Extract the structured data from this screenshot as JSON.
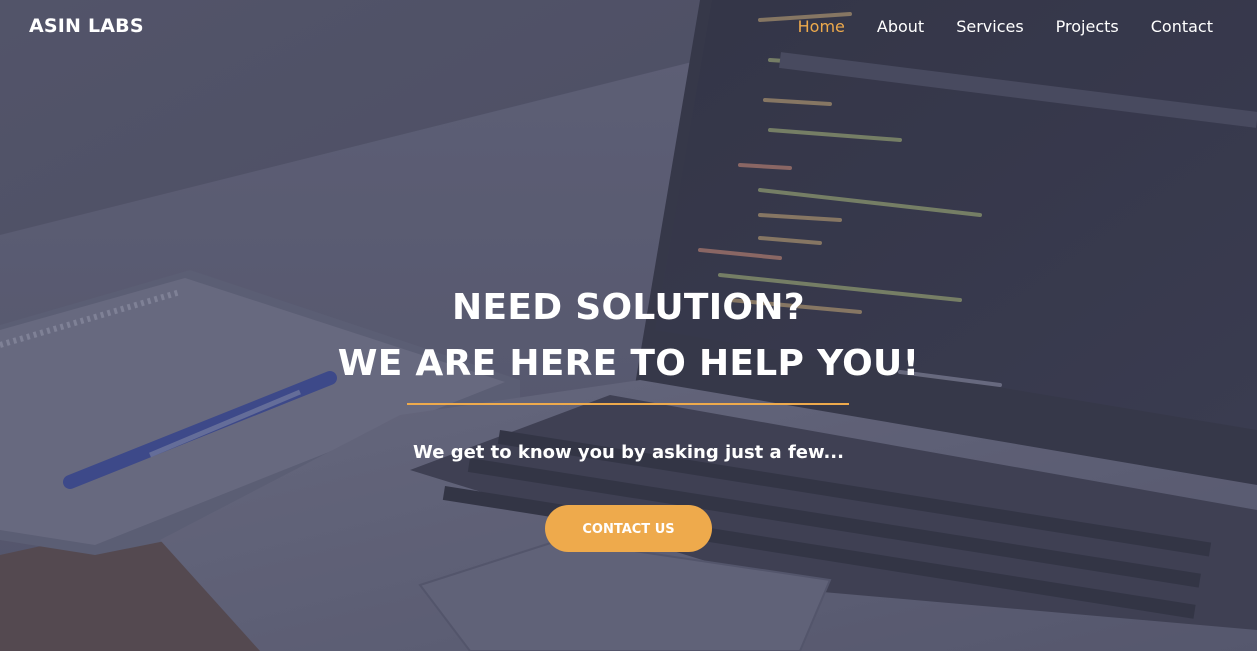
{
  "navbar": {
    "brand": "ASIN LABS",
    "links": [
      {
        "label": "Home",
        "active": true
      },
      {
        "label": "About",
        "active": false
      },
      {
        "label": "Services",
        "active": false
      },
      {
        "label": "Projects",
        "active": false
      },
      {
        "label": "Contact",
        "active": false
      }
    ]
  },
  "hero": {
    "headline_line1": "NEED SOLUTION?",
    "headline_line2": "WE ARE HERE TO HELP YOU!",
    "subtext": "We get to know you by asking just a few...",
    "cta_label": "CONTACT US",
    "background_image": "laptop-notebook-pen-photo"
  },
  "colors": {
    "accent": "#eeaa4c",
    "text": "#ffffff",
    "overlay": "#464862"
  }
}
